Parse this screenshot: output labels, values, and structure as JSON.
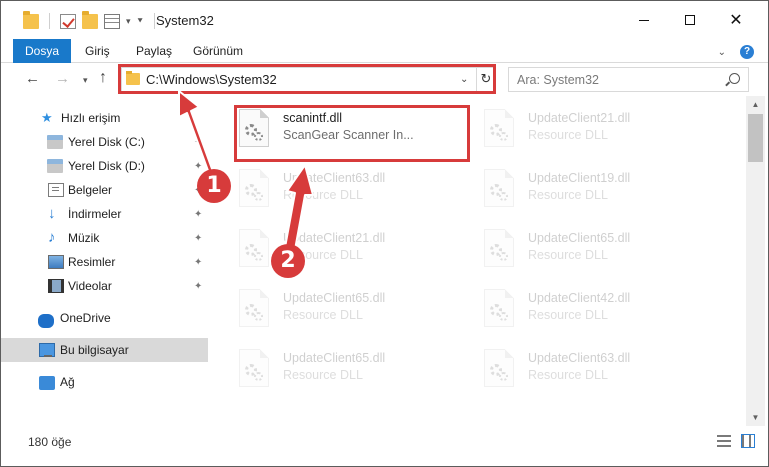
{
  "window": {
    "title": "System32"
  },
  "ribbon": {
    "tabs": [
      "Dosya",
      "Giriş",
      "Paylaş",
      "Görünüm"
    ],
    "active_tab": "Dosya",
    "accent_color": "#1979ca"
  },
  "navigation": {
    "address": "C:\\Windows\\System32",
    "search_placeholder": "Ara: System32"
  },
  "sidebar": {
    "items": [
      {
        "label": "Hızlı erişim",
        "icon": "star-icon",
        "pinned": false
      },
      {
        "label": "Yerel Disk (C:)",
        "icon": "disk-icon",
        "pinned": true
      },
      {
        "label": "Yerel Disk (D:)",
        "icon": "disk-icon",
        "pinned": true
      },
      {
        "label": "Belgeler",
        "icon": "documents-icon",
        "pinned": true
      },
      {
        "label": "İndirmeler",
        "icon": "download-icon",
        "pinned": true
      },
      {
        "label": "Müzik",
        "icon": "music-icon",
        "pinned": true
      },
      {
        "label": "Resimler",
        "icon": "pictures-icon",
        "pinned": true
      },
      {
        "label": "Videolar",
        "icon": "video-icon",
        "pinned": true
      },
      {
        "label": "OneDrive",
        "icon": "cloud-icon",
        "pinned": false
      },
      {
        "label": "Bu bilgisayar",
        "icon": "computer-icon",
        "pinned": false,
        "selected": true
      },
      {
        "label": "Ağ",
        "icon": "network-icon",
        "pinned": false
      }
    ]
  },
  "files": [
    {
      "name": "scanintf.dll",
      "type": "ScanGear Scanner In...",
      "highlighted": true
    },
    {
      "name": "UpdateClient21.dll",
      "type": "Resource DLL"
    },
    {
      "name": "UpdateClient63.dll",
      "type": "Resource DLL"
    },
    {
      "name": "UpdateClient19.dll",
      "type": "Resource DLL"
    },
    {
      "name": "UpdateClient21.dll",
      "type": "Resource DLL"
    },
    {
      "name": "UpdateClient65.dll",
      "type": "Resource DLL"
    },
    {
      "name": "UpdateClient65.dll",
      "type": "Resource DLL"
    },
    {
      "name": "UpdateClient42.dll",
      "type": "Resource DLL"
    },
    {
      "name": "UpdateClient65.dll",
      "type": "Resource DLL"
    },
    {
      "name": "UpdateClient63.dll",
      "type": "Resource DLL"
    }
  ],
  "status": {
    "item_count": "180 öğe"
  },
  "annotations": {
    "step1": "1",
    "step2": "2",
    "highlight_color": "#d73b3b"
  }
}
